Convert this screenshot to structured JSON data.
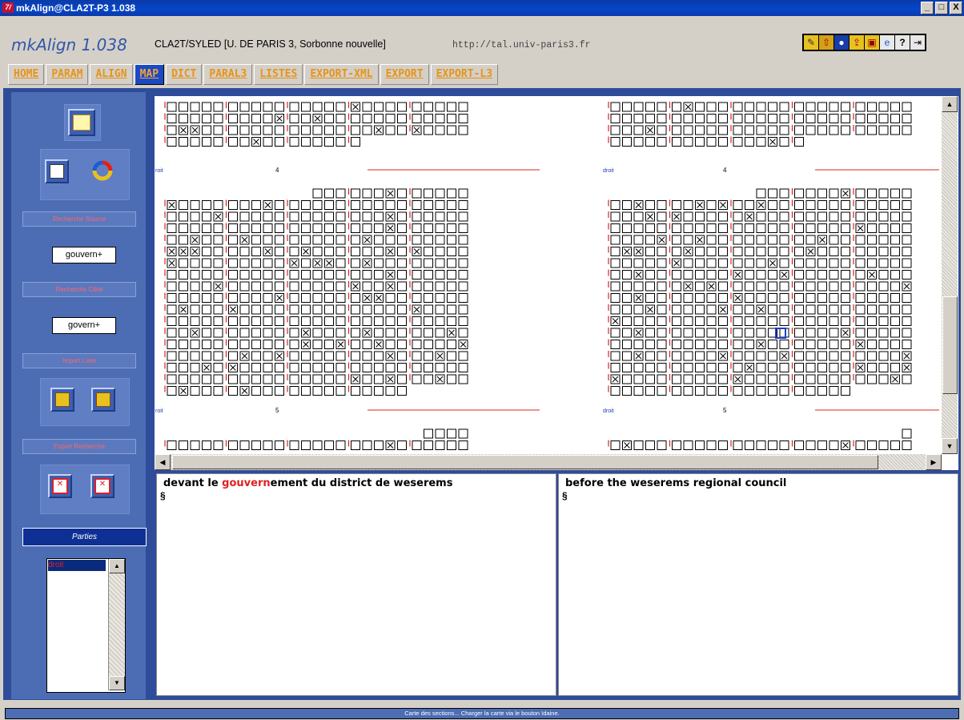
{
  "window": {
    "title": "mkAlign@CLA2T-P3 1.038",
    "app_icon_text": "7/",
    "controls": [
      "_",
      "□",
      "X"
    ]
  },
  "header": {
    "brand": "mkAlign 1.038",
    "affiliation": "CLA2T/SYLED [U. DE PARIS 3, Sorbonne nouvelle]",
    "url": "http://tal.univ-paris3.fr",
    "toolbar_icons": [
      "pencil-icon",
      "up-arrow-icon",
      "disc-icon",
      "export-icon",
      "image-icon",
      "browser-icon",
      "help-icon",
      "exit-icon"
    ]
  },
  "tabs": [
    {
      "label": "HOME",
      "active": false
    },
    {
      "label": "PARAM",
      "active": false
    },
    {
      "label": "ALIGN",
      "active": false
    },
    {
      "label": "MAP",
      "active": true
    },
    {
      "label": "DICT",
      "active": false
    },
    {
      "label": "PARAL3",
      "active": false
    },
    {
      "label": "LISTES",
      "active": false
    },
    {
      "label": "EXPORT-XML",
      "active": false
    },
    {
      "label": "EXPORT",
      "active": false
    },
    {
      "label": "EXPORT-L3",
      "active": false
    }
  ],
  "sidebar": {
    "source_search_label": "Recherche Source",
    "source_search_value": "gouvern+",
    "target_search_label": "Recherche Cible",
    "target_search_value": "govern+",
    "import_label": "Import Liste",
    "export_label": "Export Recherche",
    "parties_label": "Parties",
    "parties_items": [
      "droit"
    ]
  },
  "map": {
    "left_column": {
      "part_label": "roit",
      "sections": [
        "4",
        "5"
      ]
    },
    "right_column": {
      "part_label": "droit",
      "sections": [
        "4",
        "5"
      ]
    }
  },
  "source_text": {
    "prefix": "devant le ",
    "highlight": "gouvern",
    "suffix": "ement du district de weserems",
    "marker": "§"
  },
  "target_text": {
    "text": "before the weserems regional council",
    "marker": "§"
  },
  "status": "Carte des sections... Charger la carte via le bouton Idaine.",
  "colors": {
    "active_tab": "#1a49c4",
    "tab_text": "#e89317",
    "sidebar": "#4c6db3",
    "highlight": "#e02020",
    "section_line": "#e02020"
  }
}
